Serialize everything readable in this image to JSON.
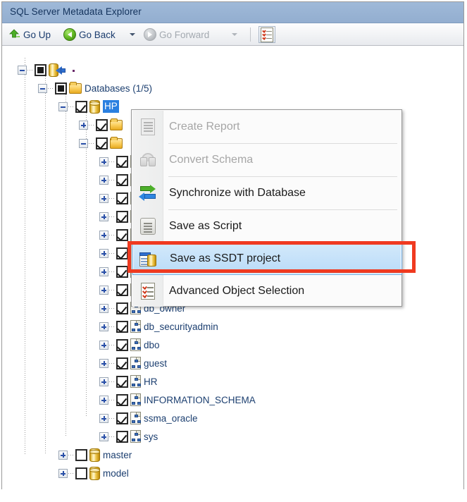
{
  "window": {
    "title": "SQL Server Metadata Explorer"
  },
  "toolbar": {
    "go_up": {
      "label": "Go Up",
      "icon": "arrow-up-green-icon",
      "enabled": true
    },
    "go_back": {
      "label": "Go Back",
      "icon": "arrow-left-green-circle-icon",
      "enabled": true
    },
    "go_back_dropdown": {
      "icon": "chevron-down-icon",
      "enabled": true
    },
    "go_forward": {
      "label": "Go Forward",
      "icon": "arrow-right-gray-circle-icon",
      "enabled": false
    },
    "go_forward_dropdown": {
      "icon": "chevron-down-icon",
      "enabled": false
    },
    "object_selection_button": {
      "icon": "checklist-icon",
      "enabled": true
    }
  },
  "tree": {
    "nodes": [
      {
        "label": ".",
        "icon": "server-icon",
        "check": "filled",
        "expander": "minus",
        "depth": 0
      },
      {
        "label": "Databases (1/5)",
        "icon": "folder-icon",
        "check": "filled",
        "expander": "minus",
        "depth": 1
      },
      {
        "label": "HP",
        "icon": "database-icon",
        "check": "checked",
        "expander": "minus",
        "depth": 2,
        "selected": true
      },
      {
        "label": "",
        "icon": "folder-icon",
        "check": "checked",
        "expander": "plus",
        "depth": 3
      },
      {
        "label": "",
        "icon": "folder-icon",
        "check": "checked",
        "expander": "minus",
        "depth": 3
      },
      {
        "label": "",
        "icon": "schema-icon",
        "check": "checked",
        "expander": "plus",
        "depth": 4
      },
      {
        "label": "",
        "icon": "schema-icon",
        "check": "checked",
        "expander": "plus",
        "depth": 4
      },
      {
        "label": "",
        "icon": "schema-icon",
        "check": "checked",
        "expander": "plus",
        "depth": 4
      },
      {
        "label": "",
        "icon": "schema-icon",
        "check": "checked",
        "expander": "plus",
        "depth": 4
      },
      {
        "label": "",
        "icon": "schema-icon",
        "check": "checked",
        "expander": "plus",
        "depth": 4
      },
      {
        "label": "",
        "icon": "schema-icon",
        "check": "checked",
        "expander": "plus",
        "depth": 4
      },
      {
        "label": "",
        "icon": "schema-icon",
        "check": "checked",
        "expander": "plus",
        "depth": 4
      },
      {
        "label": "",
        "icon": "schema-icon",
        "check": "checked",
        "expander": "plus",
        "depth": 4
      },
      {
        "label": "db_owner",
        "icon": "schema-icon",
        "check": "checked",
        "expander": "plus",
        "depth": 4
      },
      {
        "label": "db_securityadmin",
        "icon": "schema-icon",
        "check": "checked",
        "expander": "plus",
        "depth": 4
      },
      {
        "label": "dbo",
        "icon": "schema-icon",
        "check": "checked",
        "expander": "plus",
        "depth": 4
      },
      {
        "label": "guest",
        "icon": "schema-icon",
        "check": "checked",
        "expander": "plus",
        "depth": 4
      },
      {
        "label": "HR",
        "icon": "schema-icon",
        "check": "checked",
        "expander": "plus",
        "depth": 4
      },
      {
        "label": "INFORMATION_SCHEMA",
        "icon": "schema-icon",
        "check": "checked",
        "expander": "plus",
        "depth": 4
      },
      {
        "label": "ssma_oracle",
        "icon": "schema-icon",
        "check": "checked",
        "expander": "plus",
        "depth": 4
      },
      {
        "label": "sys",
        "icon": "schema-icon",
        "check": "checked",
        "expander": "plus",
        "depth": 4
      },
      {
        "label": "master",
        "icon": "database-icon",
        "check": "empty",
        "expander": "plus",
        "depth": 2
      },
      {
        "label": "model",
        "icon": "database-icon",
        "check": "empty",
        "expander": "plus",
        "depth": 2
      }
    ]
  },
  "context_menu": {
    "items": [
      {
        "label": "Create Report",
        "icon": "report-icon",
        "enabled": false,
        "selected": false
      },
      {
        "label": "Convert Schema",
        "icon": "convert-icon",
        "enabled": false,
        "selected": false
      },
      {
        "label": "Synchronize with Database",
        "icon": "sync-icon",
        "enabled": true,
        "selected": false
      },
      {
        "label": "Save as Script",
        "icon": "script-icon",
        "enabled": true,
        "selected": false
      },
      {
        "label": "Save as SSDT project",
        "icon": "ssdt-icon",
        "enabled": true,
        "selected": true
      },
      {
        "label": "Advanced Object Selection",
        "icon": "checklist-icon",
        "enabled": true,
        "selected": false
      }
    ]
  },
  "annotation": {
    "highlight_color": "#f03a20",
    "target": "Save as SSDT project"
  },
  "colors": {
    "titlebar": "#96b1d3",
    "selection": "#2a7fe0",
    "menu_selection": "#b9dbf8",
    "text": "#1c3f70"
  }
}
